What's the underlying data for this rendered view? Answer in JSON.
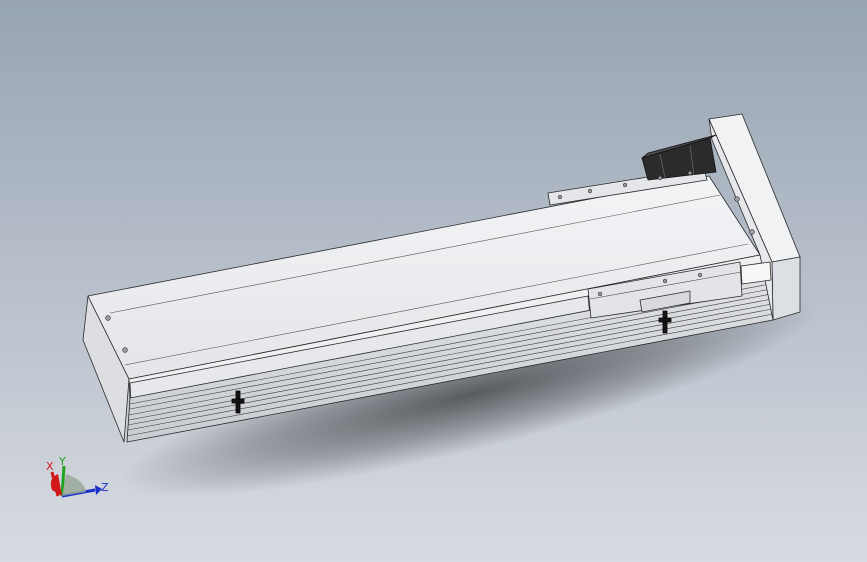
{
  "viewport": {
    "background_top": "#97a4b4",
    "background_bottom": "#d8dbe1"
  },
  "model": {
    "body_color": "#e9eaec",
    "edge_color": "#2a2a2a",
    "motor_color": "#2b2b2b"
  },
  "triad": {
    "x_label": "X",
    "y_label": "Y",
    "z_label": "Z",
    "x_color": "#d01818",
    "y_color": "#1fa01f",
    "z_color": "#1830c8"
  }
}
